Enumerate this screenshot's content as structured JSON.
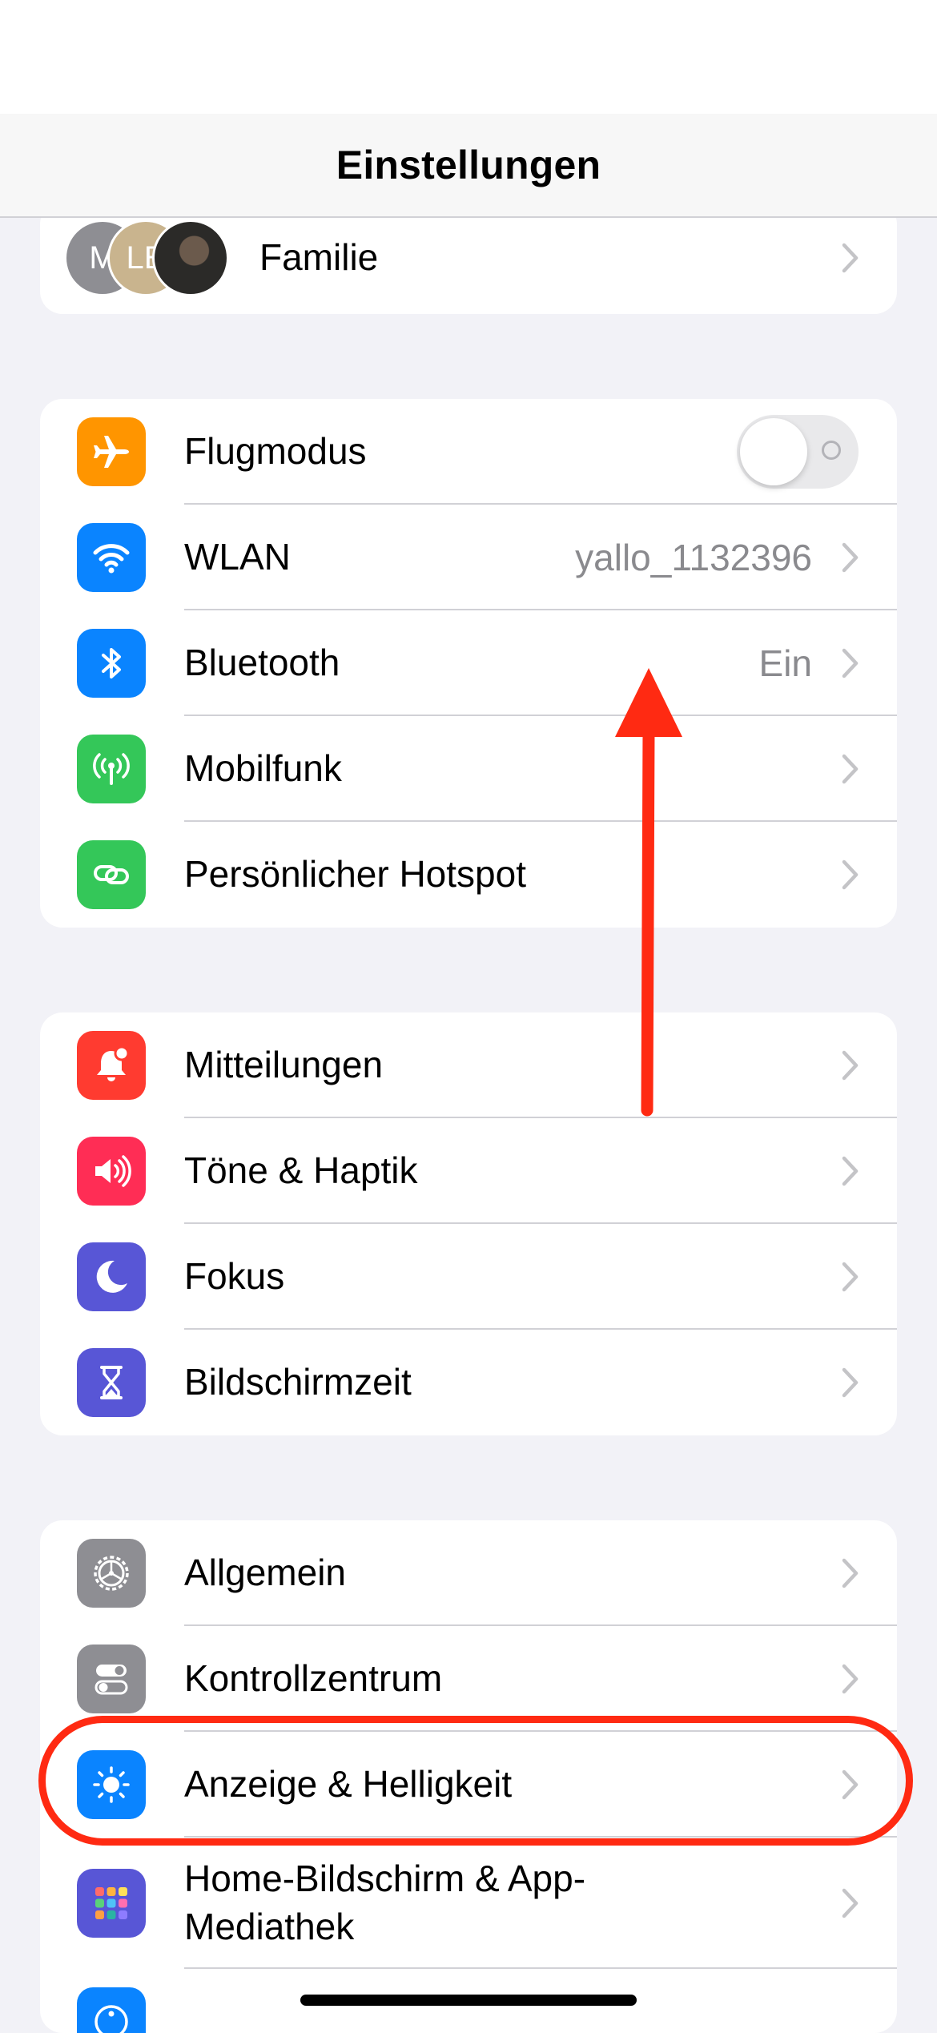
{
  "nav": {
    "title": "Einstellungen"
  },
  "family": {
    "label": "Familie",
    "avatars": [
      {
        "initial": "M",
        "color": "#8E8E93"
      },
      {
        "initial": "LE",
        "color": "#C9B48E"
      },
      {
        "initial": "",
        "color": "#2B2A28"
      }
    ]
  },
  "connectivity": {
    "airplane": {
      "label": "Flugmodus",
      "icon": "airplane-icon",
      "color": "#FF9500",
      "toggle_on": false
    },
    "wlan": {
      "label": "WLAN",
      "value": "yallo_1132396",
      "icon": "wifi-icon",
      "color": "#0A84FF"
    },
    "bluetooth": {
      "label": "Bluetooth",
      "value": "Ein",
      "icon": "bluetooth-icon",
      "color": "#0A84FF"
    },
    "cellular": {
      "label": "Mobilfunk",
      "icon": "antenna-icon",
      "color": "#34C759"
    },
    "hotspot": {
      "label": "Persönlicher Hotspot",
      "icon": "link-icon",
      "color": "#34C759"
    }
  },
  "notifications_group": {
    "notifications": {
      "label": "Mitteilungen",
      "icon": "bell-icon",
      "color": "#FF3B30"
    },
    "sounds": {
      "label": "Töne & Haptik",
      "icon": "speaker-icon",
      "color": "#FF2D55"
    },
    "focus": {
      "label": "Fokus",
      "icon": "moon-icon",
      "color": "#5856D6"
    },
    "screen_time": {
      "label": "Bildschirmzeit",
      "icon": "hourglass-icon",
      "color": "#5856D6"
    }
  },
  "general_group": {
    "general": {
      "label": "Allgemein",
      "icon": "gear-icon",
      "color": "#8E8E93"
    },
    "control_center": {
      "label": "Kontrollzentrum",
      "icon": "switches-icon",
      "color": "#8E8E93"
    },
    "display": {
      "label": "Anzeige & Helligkeit",
      "icon": "sun-icon",
      "color": "#0A84FF"
    },
    "home_screen": {
      "label": "Home-Bildschirm & App-Mediathek",
      "icon": "app-grid-icon",
      "color": "#5856D6"
    }
  },
  "annotation": {
    "color": "#FF2A12"
  }
}
